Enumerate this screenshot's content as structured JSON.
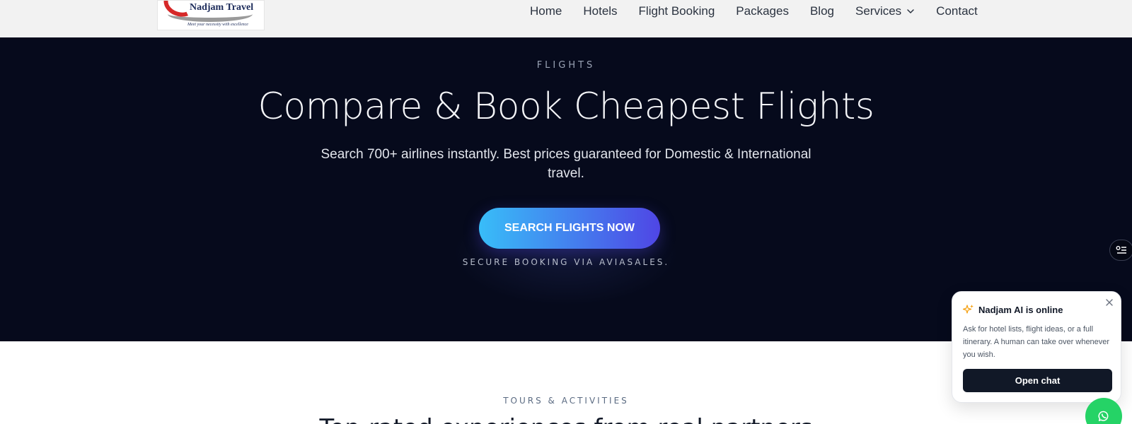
{
  "header": {
    "logo": {
      "name": "Nadjam Travel",
      "tagline": "Meet your necessity with excellence"
    },
    "nav": [
      {
        "label": "Home",
        "icon": null
      },
      {
        "label": "Hotels",
        "icon": null
      },
      {
        "label": "Flight Booking",
        "icon": null
      },
      {
        "label": "Packages",
        "icon": null
      },
      {
        "label": "Blog",
        "icon": null
      },
      {
        "label": "Services",
        "icon": "chevron-down-icon"
      },
      {
        "label": "Contact",
        "icon": null
      }
    ]
  },
  "hero": {
    "eyebrow": "FLIGHTS",
    "title": "Compare & Book Cheapest Flights",
    "subtitle": "Search 700+ airlines instantly. Best prices guaranteed for Domestic & International travel.",
    "cta_label": "SEARCH FLIGHTS NOW",
    "secure_note": "SECURE BOOKING VIA AVIASALES."
  },
  "tours": {
    "eyebrow": "TOURS & ACTIVITIES",
    "heading": "Top-rated experiences from real partners"
  },
  "chat": {
    "title": "Nadjam AI is online",
    "body": "Ask for hotel lists, flight ideas, or a full itinerary. A human can take over whenever you wish.",
    "button_label": "Open chat"
  },
  "colors": {
    "hero_bg": "#060a1c",
    "header_bg": "#f2f2f2",
    "cta_gradient_start": "#38bdf8",
    "cta_gradient_end": "#4f46e5",
    "chat_button_bg": "#111827",
    "whatsapp_green": "#25d366",
    "sparkle": "#f59e0b"
  },
  "icons": {
    "side_tab": "list-settings-icon",
    "chat_title": "sparkle-icon",
    "chat_close": "close-icon",
    "floating_button": "whatsapp-icon"
  }
}
